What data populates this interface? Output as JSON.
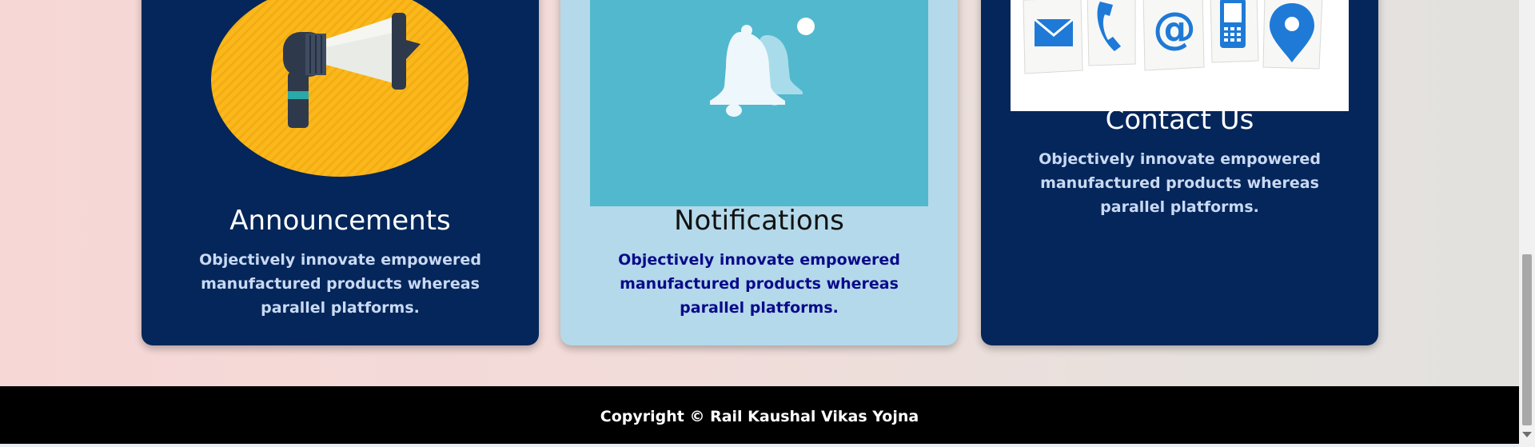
{
  "cards": [
    {
      "id": "announcements",
      "title": "Announcements",
      "text": "Objectively innovate empowered manufactured products whereas parallel platforms.",
      "icon": "megaphone-icon"
    },
    {
      "id": "notifications",
      "title": "Notifications",
      "text": "Objectively innovate empowered manufactured products whereas parallel platforms.",
      "icon": "bell-icon"
    },
    {
      "id": "contact",
      "title": "Contact Us",
      "text": "Objectively innovate empowered manufactured products whereas parallel platforms.",
      "icon": "contact-icons"
    }
  ],
  "footer": {
    "copyright": "Copyright © Rail Kaushal Vikas Yojna"
  },
  "colors": {
    "dark_card": "#04265a",
    "light_card": "#b4d9ea",
    "accent_yellow": "#fbb81c",
    "notif_bg": "#52b8cd",
    "footer_bg": "#000000"
  }
}
